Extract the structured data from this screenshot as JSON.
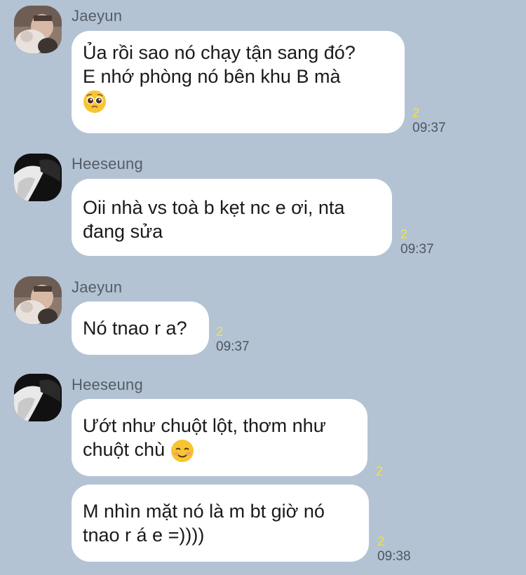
{
  "messages": [
    {
      "sender": "Jaeyun",
      "avatar": "jaeyun-avatar",
      "lines": [
        "Ủa rồi sao nó chạy tận sang đó?",
        "E nhớ phòng nó bên khu B mà",
        ""
      ],
      "emoji": "pleading-face",
      "read_count": "2",
      "time": "09:37"
    },
    {
      "sender": "Heeseung",
      "avatar": "heeseung-avatar",
      "lines": [
        "Oii nhà vs toà b kẹt nc e ơi, nta",
        "đang sửa"
      ],
      "read_count": "2",
      "time": "09:37"
    },
    {
      "sender": "Jaeyun",
      "avatar": "jaeyun-avatar",
      "lines": [
        "Nó tnao r a?"
      ],
      "read_count": "2",
      "time": "09:37"
    },
    {
      "sender": "Heeseung",
      "avatar": "heeseung-avatar",
      "lines": [
        "Ướt như chuột lột, thơm như",
        "chuột chù "
      ],
      "emoji": "smiling-face",
      "read_count": "2",
      "time": ""
    },
    {
      "sender": "",
      "lines": [
        "M nhìn mặt nó là m bt giờ nó",
        "tnao r á e =))))"
      ],
      "read_count": "2",
      "time": "09:38"
    }
  ],
  "colors": {
    "background": "#b3c3d4",
    "bubble": "#ffffff",
    "read_count": "#f1e33b"
  }
}
